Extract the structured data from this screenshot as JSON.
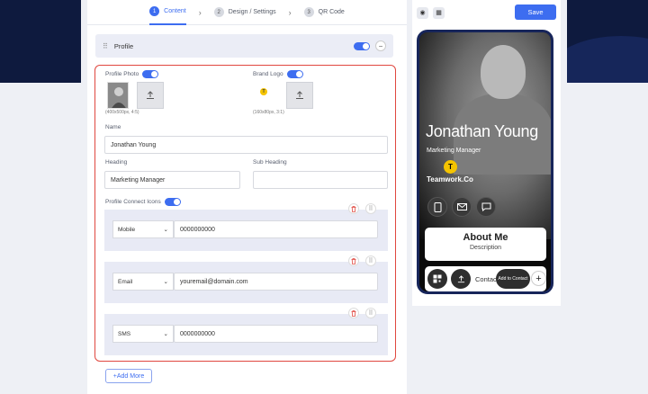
{
  "steps": [
    {
      "num": "1",
      "label": "Content"
    },
    {
      "num": "2",
      "label": "Design / Settings"
    },
    {
      "num": "3",
      "label": "QR Code"
    }
  ],
  "section": {
    "title": "Profile"
  },
  "form": {
    "profile_photo_label": "Profile Photo",
    "profile_photo_hint": "(400x500px, 4:5)",
    "brand_logo_label": "Brand Logo",
    "brand_logo_hint": "(160x80px, 3:1)",
    "name_label": "Name",
    "name_value": "Jonathan Young",
    "heading_label": "Heading",
    "heading_value": "Marketing Manager",
    "subheading_label": "Sub Heading",
    "subheading_value": "",
    "connect_icons_label": "Profile Connect Icons",
    "connections": [
      {
        "type": "Mobile",
        "value": "0000000000"
      },
      {
        "type": "Email",
        "value": "youremail@domain.com"
      },
      {
        "type": "SMS",
        "value": "0000000000"
      }
    ],
    "add_more": "+Add More"
  },
  "toolbar": {
    "save": "Save"
  },
  "preview": {
    "name": "Jonathan Young",
    "role": "Marketing Manager",
    "logo_letter": "T",
    "company": "Teamwork.Co",
    "about_title": "About Me",
    "about_sub": "Description",
    "contact": "Contact Us",
    "add_contact": "Add to Contact",
    "plus": "+"
  },
  "colors": {
    "accent": "#3d6df0",
    "error_border": "#e0473f",
    "navy": "#0e1a3e",
    "logo": "#f5c400"
  }
}
